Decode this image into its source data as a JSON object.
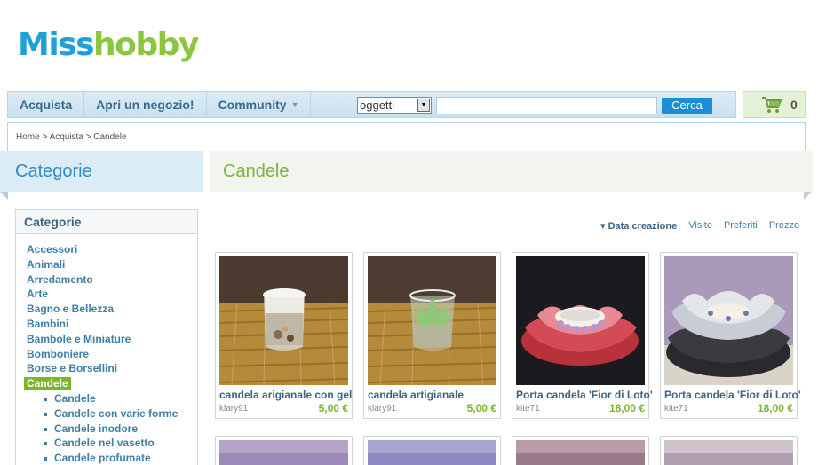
{
  "logo": {
    "part1": "Miss",
    "part2": "hobby"
  },
  "nav": {
    "items": [
      {
        "label": "Acquista"
      },
      {
        "label": "Apri un negozio!"
      },
      {
        "label": "Community"
      }
    ],
    "search_select_value": "oggetti",
    "search_button": "Cerca",
    "cart_count": "0"
  },
  "breadcrumb": "Home > Acquista > Candele",
  "sidebar": {
    "header": "Categorie",
    "box_title": "Categorie",
    "categories": [
      "Accessori",
      "Animali",
      "Arredamento",
      "Arte",
      "Bagno e Bellezza",
      "Bambini",
      "Bambole e Miniature",
      "Bomboniere",
      "Borse e Borsellini"
    ],
    "active_category": "Candele",
    "subcategories": [
      "Candele",
      "Candele con varie forme",
      "Candele inodore",
      "Candele nel vasetto",
      "Candele profumate"
    ]
  },
  "main": {
    "title": "Candele",
    "sort": {
      "active": "▾ Data creazione",
      "options": [
        "Visite",
        "Preferiti",
        "Prezzo"
      ]
    },
    "products": [
      {
        "title": "candela arigianale con gel",
        "seller": "klary91",
        "price": "5,00 €"
      },
      {
        "title": "candela artigianale",
        "seller": "klary91",
        "price": "5,00 €"
      },
      {
        "title": "Porta candela 'Fior di Loto'",
        "seller": "kite71",
        "price": "18,00 €"
      },
      {
        "title": "Porta candela 'Fior di Loto'",
        "seller": "kite71",
        "price": "18,00 €"
      }
    ]
  },
  "colors": {
    "accent_blue": "#1ea0d8",
    "accent_green": "#8cc63f",
    "link_blue": "#3f7fa6"
  }
}
